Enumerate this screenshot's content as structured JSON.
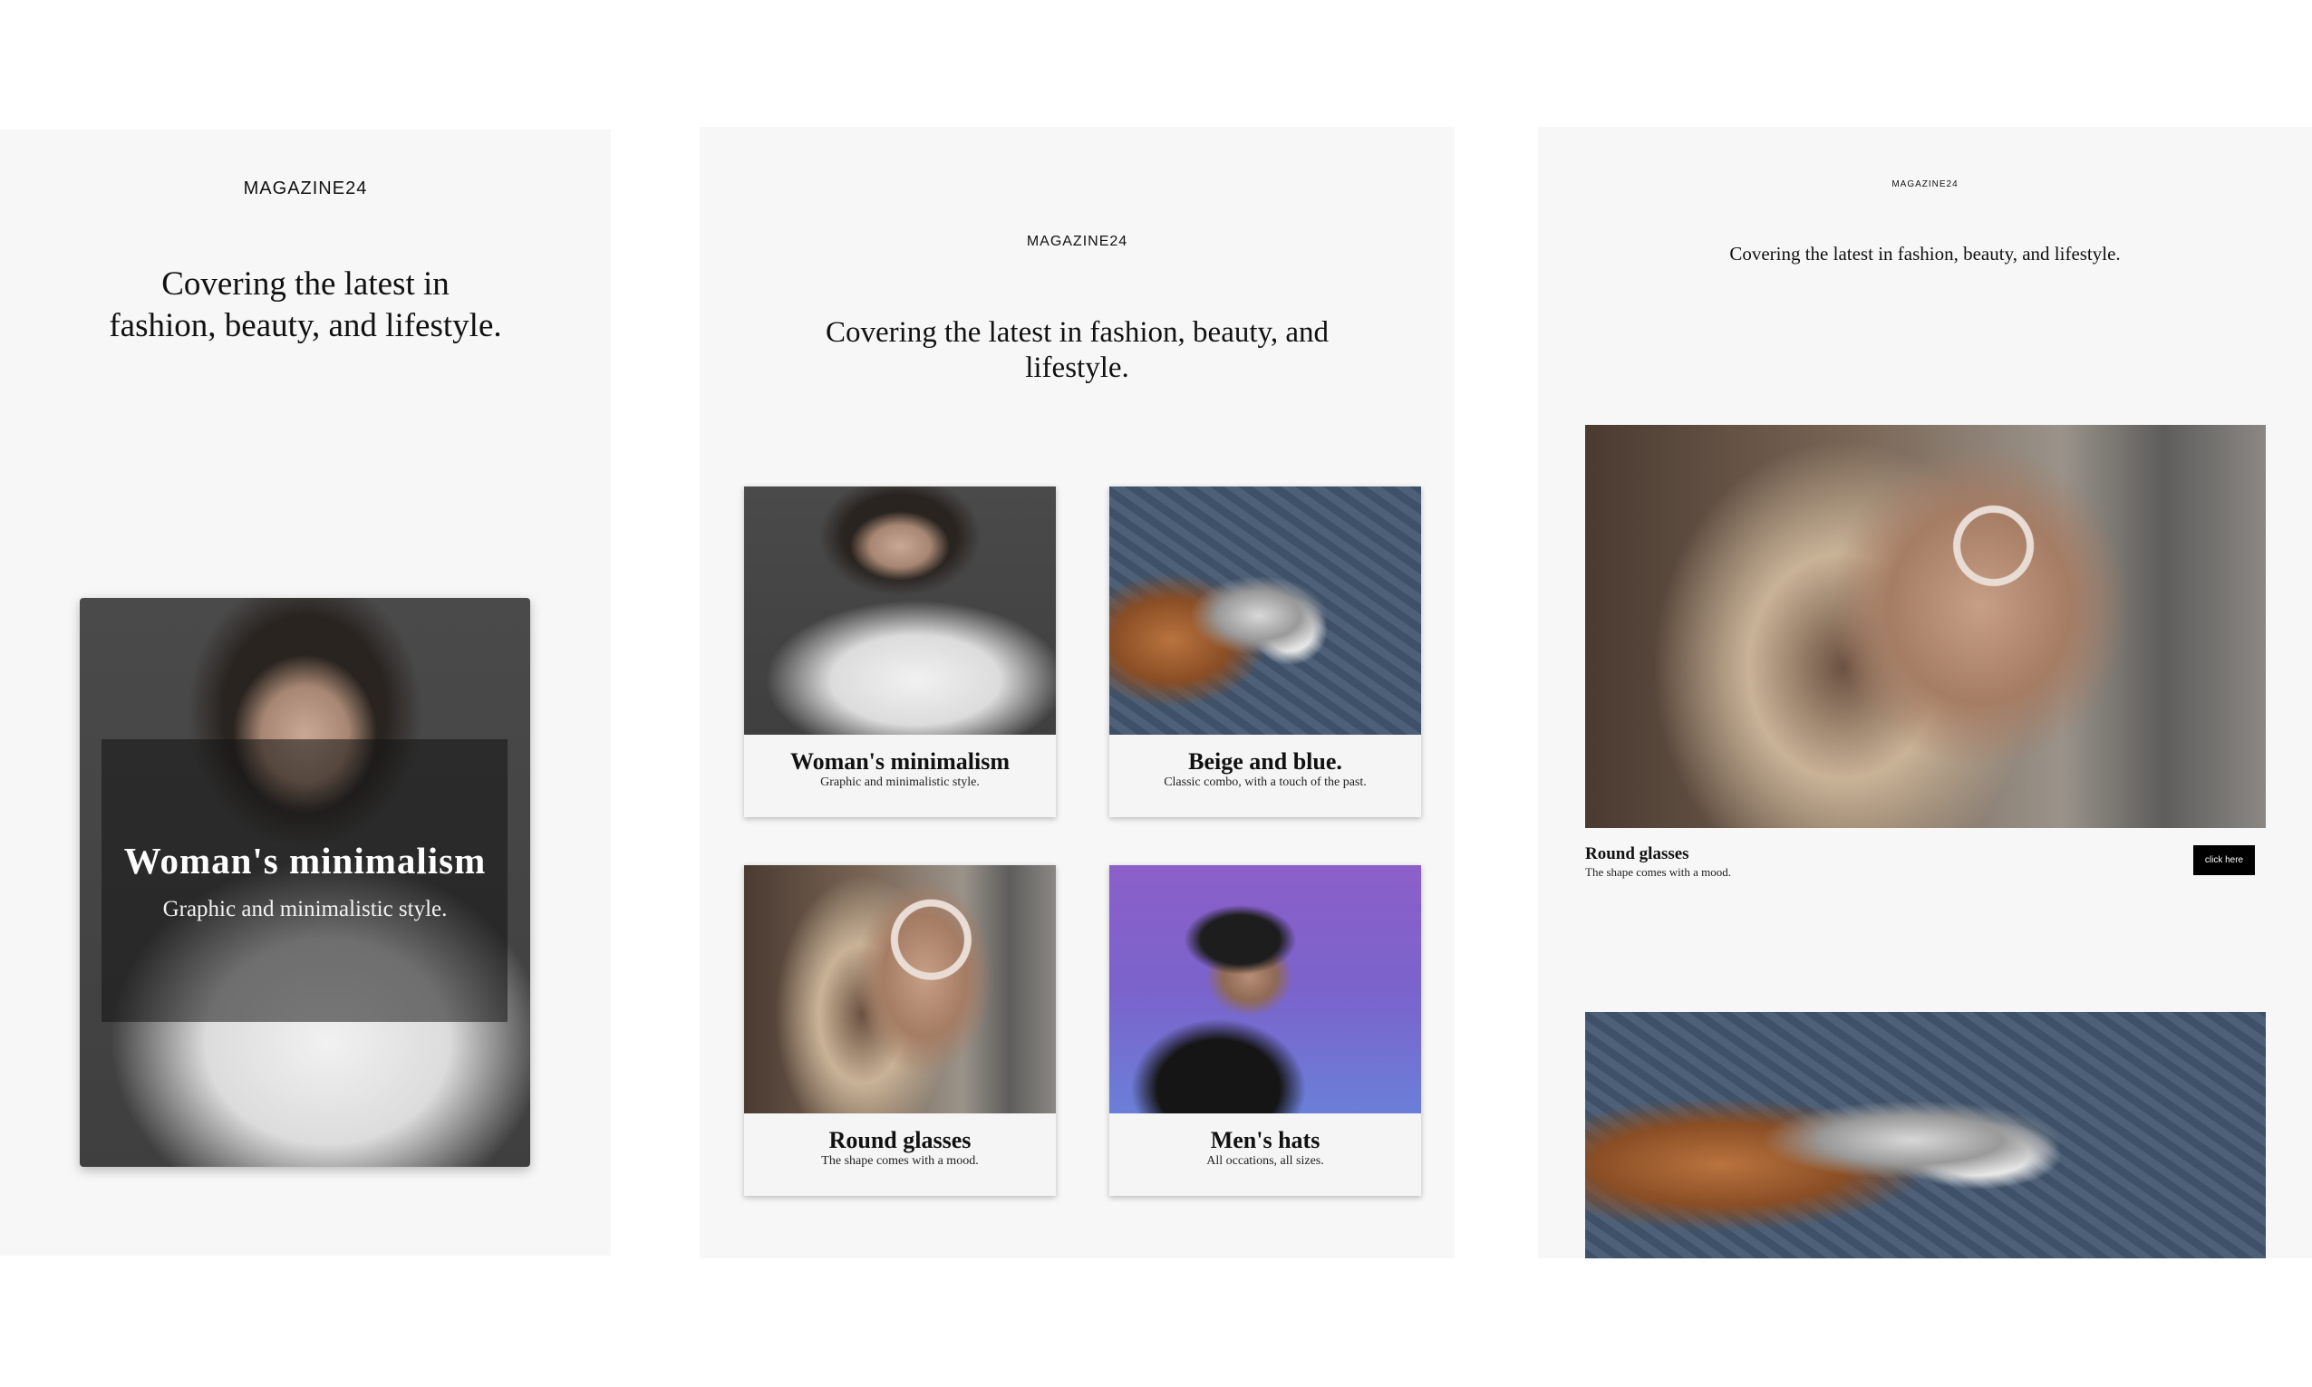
{
  "brand": "MAGAZINE24",
  "tagline": {
    "line1": "Covering the latest in",
    "line2": "fashion, beauty, and lifestyle.",
    "wide_line1": "Covering the latest in fashion, beauty, and",
    "wide_line2": "lifestyle.",
    "single": "Covering the latest in fashion, beauty, and lifestyle."
  },
  "hero": {
    "title": "Woman's minimalism",
    "subtitle": "Graphic and minimalistic style."
  },
  "cards": [
    {
      "title": "Woman's minimalism",
      "subtitle": "Graphic and minimalistic style."
    },
    {
      "title": "Beige and blue.",
      "subtitle": "Classic combo, with a touch of the past."
    },
    {
      "title": "Round glasses",
      "subtitle": "The shape comes with a mood."
    },
    {
      "title": "Men's hats",
      "subtitle": "All occations, all sizes."
    }
  ],
  "feature": {
    "title": "Round glasses",
    "subtitle": "The shape comes with a mood.",
    "button_label": "click here"
  },
  "images": [
    "woman-portrait",
    "watch-sleeve",
    "round-glasses-portrait",
    "man-in-cap"
  ]
}
